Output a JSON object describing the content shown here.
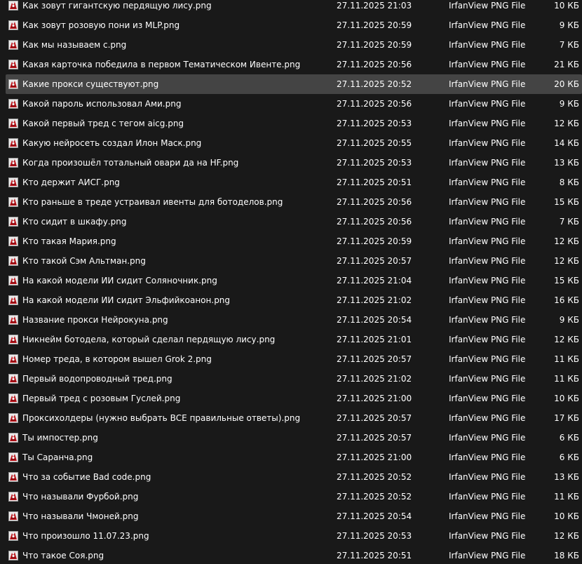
{
  "colors": {
    "background": "#191919",
    "selected_row": "#444444",
    "text": "#ffffff"
  },
  "icon": "irfanview-png-icon",
  "files": [
    {
      "name": "Как зовут гигантскую пердящую лису.png",
      "date": "27.11.2025 21:03",
      "type": "IrfanView PNG File",
      "size": "10 КБ"
    },
    {
      "name": "Как зовут розовую пони из MLP.png",
      "date": "27.11.2025 20:59",
      "type": "IrfanView PNG File",
      "size": "9 КБ"
    },
    {
      "name": "Как мы называем c.png",
      "date": "27.11.2025 20:59",
      "type": "IrfanView PNG File",
      "size": "7 КБ"
    },
    {
      "name": "Какая карточка победила в первом Тематическом Ивенте.png",
      "date": "27.11.2025 20:56",
      "type": "IrfanView PNG File",
      "size": "21 КБ"
    },
    {
      "name": "Какие прокси существуют.png",
      "date": "27.11.2025 20:52",
      "type": "IrfanView PNG File",
      "size": "20 КБ",
      "selected": true
    },
    {
      "name": "Какой пароль использовал Ами.png",
      "date": "27.11.2025 20:56",
      "type": "IrfanView PNG File",
      "size": "9 КБ"
    },
    {
      "name": "Какой первый тред с тегом aicg.png",
      "date": "27.11.2025 20:53",
      "type": "IrfanView PNG File",
      "size": "12 КБ"
    },
    {
      "name": "Какую нейросеть создал Илон Маск.png",
      "date": "27.11.2025 20:55",
      "type": "IrfanView PNG File",
      "size": "14 КБ"
    },
    {
      "name": "Когда произошёл тотальный овари да на HF.png",
      "date": "27.11.2025 20:53",
      "type": "IrfanView PNG File",
      "size": "13 КБ"
    },
    {
      "name": "Кто держит АИСГ.png",
      "date": "27.11.2025 20:51",
      "type": "IrfanView PNG File",
      "size": "8 КБ"
    },
    {
      "name": "Кто раньше в треде устраивал ивенты для ботоделов.png",
      "date": "27.11.2025 20:56",
      "type": "IrfanView PNG File",
      "size": "15 КБ"
    },
    {
      "name": "Кто сидит в шкафу.png",
      "date": "27.11.2025 20:56",
      "type": "IrfanView PNG File",
      "size": "7 КБ"
    },
    {
      "name": "Кто такая Мария.png",
      "date": "27.11.2025 20:59",
      "type": "IrfanView PNG File",
      "size": "12 КБ"
    },
    {
      "name": "Кто такой Сэм Альтман.png",
      "date": "27.11.2025 20:57",
      "type": "IrfanView PNG File",
      "size": "12 КБ"
    },
    {
      "name": "На какой модели ИИ сидит Соляночник.png",
      "date": "27.11.2025 21:04",
      "type": "IrfanView PNG File",
      "size": "15 КБ"
    },
    {
      "name": "На какой модели ИИ сидит Эльфийкоанон.png",
      "date": "27.11.2025 21:02",
      "type": "IrfanView PNG File",
      "size": "16 КБ"
    },
    {
      "name": "Название прокси Нейрокуна.png",
      "date": "27.11.2025 20:54",
      "type": "IrfanView PNG File",
      "size": "9 КБ"
    },
    {
      "name": "Никнейм ботодела, который сделал пердящую лису.png",
      "date": "27.11.2025 21:01",
      "type": "IrfanView PNG File",
      "size": "12 КБ"
    },
    {
      "name": "Номер треда, в котором вышел Grok 2.png",
      "date": "27.11.2025 20:57",
      "type": "IrfanView PNG File",
      "size": "11 КБ"
    },
    {
      "name": "Первый водопроводный тред.png",
      "date": "27.11.2025 21:02",
      "type": "IrfanView PNG File",
      "size": "11 КБ"
    },
    {
      "name": "Первый тред с розовым Гуслей.png",
      "date": "27.11.2025 21:00",
      "type": "IrfanView PNG File",
      "size": "10 КБ"
    },
    {
      "name": "Проксихолдеры (нужно выбрать ВСЕ правильные ответы).png",
      "date": "27.11.2025 20:57",
      "type": "IrfanView PNG File",
      "size": "17 КБ"
    },
    {
      "name": "Ты импостер.png",
      "date": "27.11.2025 20:57",
      "type": "IrfanView PNG File",
      "size": "6 КБ"
    },
    {
      "name": "Ты Саранча.png",
      "date": "27.11.2025 21:00",
      "type": "IrfanView PNG File",
      "size": "6 КБ"
    },
    {
      "name": "Что за событие Bad code.png",
      "date": "27.11.2025 20:52",
      "type": "IrfanView PNG File",
      "size": "13 КБ"
    },
    {
      "name": "Что называли Фурбой.png",
      "date": "27.11.2025 20:52",
      "type": "IrfanView PNG File",
      "size": "11 КБ"
    },
    {
      "name": "Что называли Чмоней.png",
      "date": "27.11.2025 20:54",
      "type": "IrfanView PNG File",
      "size": "10 КБ"
    },
    {
      "name": "Что произошло 11.07.23.png",
      "date": "27.11.2025 20:53",
      "type": "IrfanView PNG File",
      "size": "12 КБ"
    },
    {
      "name": "Что такое Соя.png",
      "date": "27.11.2025 20:51",
      "type": "IrfanView PNG File",
      "size": "18 КБ"
    }
  ]
}
